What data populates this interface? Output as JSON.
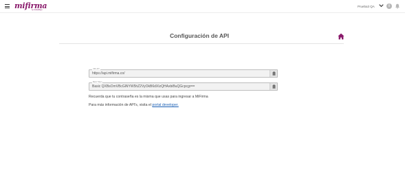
{
  "header": {
    "logo_text": "mifirma",
    "logo_tagline": "by GlobalSign",
    "account_name": "Prueba3 QA"
  },
  "page": {
    "title": "Configuración de API"
  },
  "api_url": {
    "label": "URL API",
    "value": "https://api.mifirma.co/"
  },
  "authorization": {
    "label": "Basic Token",
    "value": "Basic QXBsOmVBcGlNYW5hZ2VyOkB6dXIzQHAxbiBuQGcpcgr=="
  },
  "notes": {
    "password_reminder": "Recuerda que tu contraseña es la misma que usas para ingresar a MiFirma",
    "info_prefix": "Para más información de API's, visita el",
    "info_link": "portal developer."
  },
  "colors": {
    "brand": "#8a1a6b",
    "link": "#1a5fb4"
  },
  "icons": {
    "menu": "hamburger-menu-icon",
    "chevron": "chevron-down-icon",
    "info": "info-icon",
    "notifications": "bell-icon",
    "home": "home-icon",
    "copy": "clipboard-icon"
  }
}
